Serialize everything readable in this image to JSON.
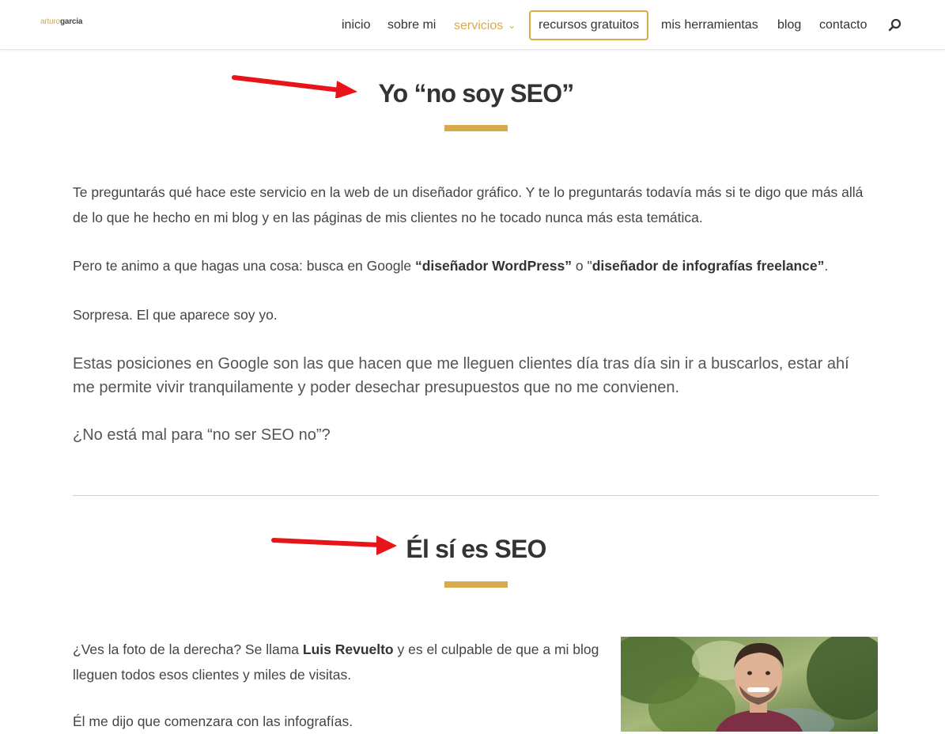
{
  "logo": {
    "part1": "arturo",
    "part2": "garcia"
  },
  "nav": {
    "inicio": "inicio",
    "sobre_mi": "sobre mi",
    "servicios": "servicios",
    "recursos": "recursos gratuitos",
    "herramientas": "mis herramientas",
    "blog": "blog",
    "contacto": "contacto",
    "search_icon": "search-icon"
  },
  "section1": {
    "title": "Yo “no soy SEO”",
    "p1": "Te preguntarás qué hace este servicio en la web de un diseñador gráfico. Y te lo preguntarás todavía más si te digo que más allá de lo que he hecho en mi blog y en las páginas de mis clientes no he tocado nunca más esta temática.",
    "p2_before": "Pero te animo a que hagas una cosa: busca en Google ",
    "p2_bold1": "“diseñador WordPress”",
    "p2_mid": " o \"",
    "p2_bold2": "diseñador de infografías freelance”",
    "p2_end": ".",
    "p3": "Sorpresa. El que aparece soy yo.",
    "p4": "Estas posiciones en Google son las que hacen que me lleguen clientes día tras día sin ir a buscarlos, estar ahí me permite vivir tranquilamente y poder desechar presupuestos que no me convienen.",
    "p5": "¿No está mal para “no ser SEO no”?"
  },
  "section2": {
    "title": "Él sí es SEO",
    "p1_before": "¿Ves la foto de la derecha? Se llama ",
    "p1_bold": "Luis Revuelto",
    "p1_after": " y es el culpable de que a mi blog lleguen todos esos clientes y miles de visitas.",
    "p2": "Él me dijo que comenzara con las infografías."
  },
  "colors": {
    "accent": "#d9a94e",
    "arrow": "#e8141a"
  }
}
